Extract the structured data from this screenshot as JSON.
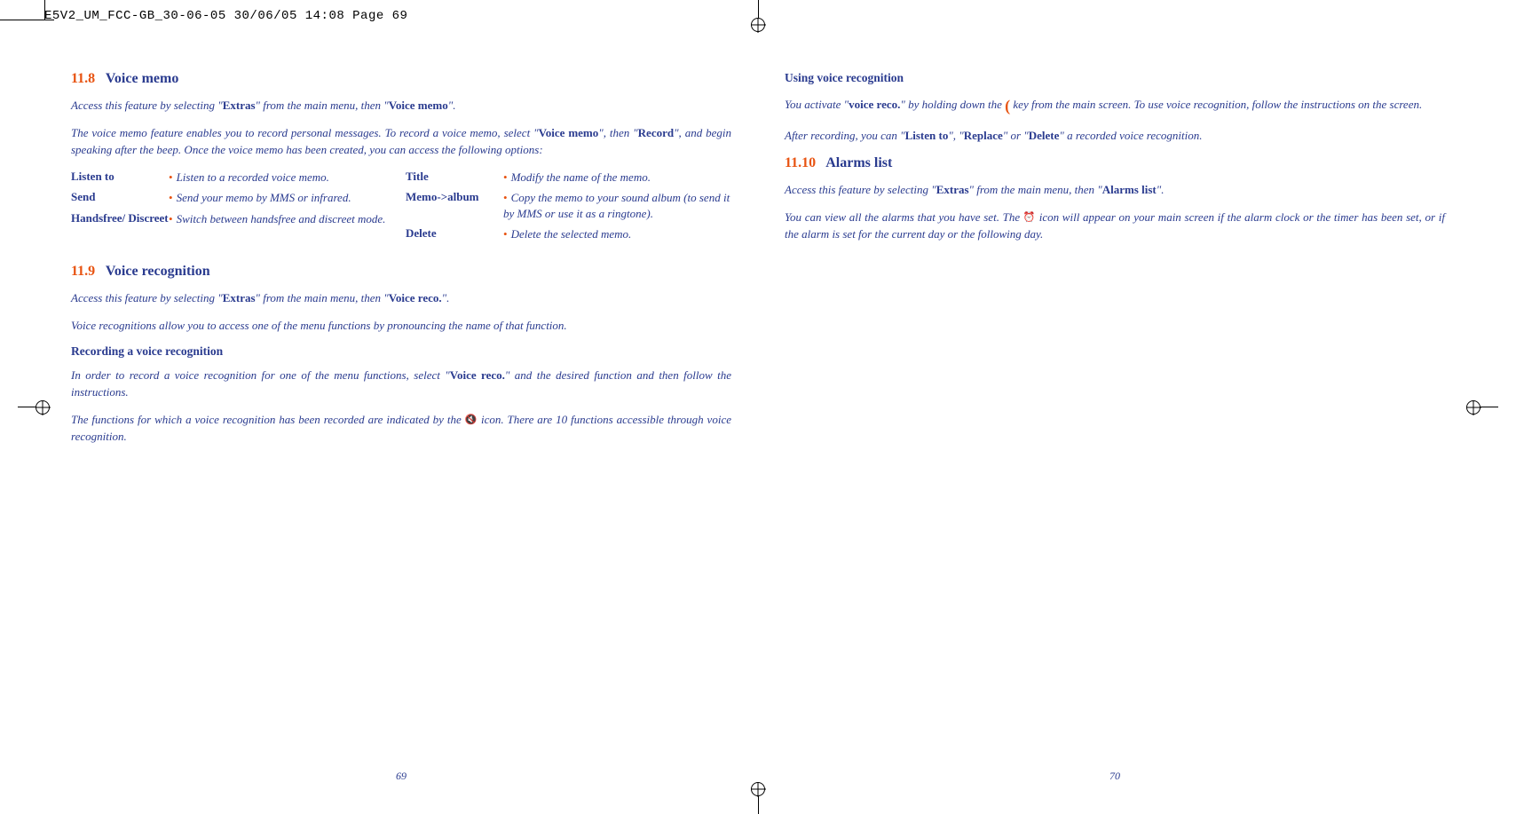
{
  "header": "E5V2_UM_FCC-GB_30-06-05  30/06/05  14:08  Page 69",
  "left": {
    "s118": {
      "num": "11.8",
      "title": "Voice memo",
      "p1a": "Access this feature by selecting \"",
      "p1b": "Extras",
      "p1c": "\" from the main menu, then \"",
      "p1d": "Voice memo",
      "p1e": "\".",
      "p2a": "The voice memo feature enables you to record personal messages. To record a voice memo, select \"",
      "p2b": "Voice memo",
      "p2c": "\", then \"",
      "p2d": "Record",
      "p2e": "\", and begin speaking after the beep. Once the voice memo has been created, you can access the following options:",
      "opt": {
        "listen_l": "Listen to",
        "listen_d": "Listen to a recorded voice memo.",
        "send_l": "Send",
        "send_d": "Send your memo by MMS or infrared.",
        "hands_l": "Handsfree/ Discreet",
        "hands_d": "Switch between handsfree and discreet mode.",
        "title_l": "Title",
        "title_d": "Modify the name of the memo.",
        "album_l": "Memo->album",
        "album_d": "Copy the memo to your sound album (to send it by MMS or use it as a ringtone).",
        "delete_l": "Delete",
        "delete_d": "Delete the selected memo."
      }
    },
    "s119": {
      "num": "11.9",
      "title": "Voice recognition",
      "p1a": "Access this feature by selecting \"",
      "p1b": "Extras",
      "p1c": "\" from the main menu, then \"",
      "p1d": "Voice reco.",
      "p1e": "\".",
      "p2": "Voice recognitions allow you to access one of the menu functions by pronouncing the name of that function.",
      "sub1": "Recording a voice recognition",
      "p3a": "In order to record a voice recognition for one of the menu functions, select \"",
      "p3b": "Voice reco.",
      "p3c": "\" and the desired function and then follow the instructions.",
      "p4a": "The functions for which a voice recognition has been recorded are indicated by the ",
      "p4b": " icon. There are 10 functions accessible through voice recognition."
    },
    "page_num": "69"
  },
  "right": {
    "sub1": "Using voice recognition",
    "p1a": "You activate \"",
    "p1b": "voice reco.",
    "p1c": "\" by holding down the ",
    "p1d": " key from the main screen. To use voice recognition, follow the instructions on the screen.",
    "p2a": "After recording, you can \"",
    "p2b": "Listen to",
    "p2c": "\", \"",
    "p2d": "Replace",
    "p2e": "\" or \"",
    "p2f": "Delete",
    "p2g": "\" a recorded voice recognition.",
    "s1110": {
      "num": "11.10",
      "title": "Alarms list",
      "p1a": "Access this feature by selecting \"",
      "p1b": "Extras",
      "p1c": "\" from the main menu, then \"",
      "p1d": "Alarms list",
      "p1e": "\".",
      "p2a": "You can view all the alarms that you have set. The ",
      "p2b": " icon will appear on your main screen if the alarm clock or the timer has been set, or if the alarm is set for the current day or the following day."
    },
    "page_num": "70"
  },
  "icons": {
    "speaker": "🔇",
    "key": "(",
    "alarm": "⏰"
  }
}
